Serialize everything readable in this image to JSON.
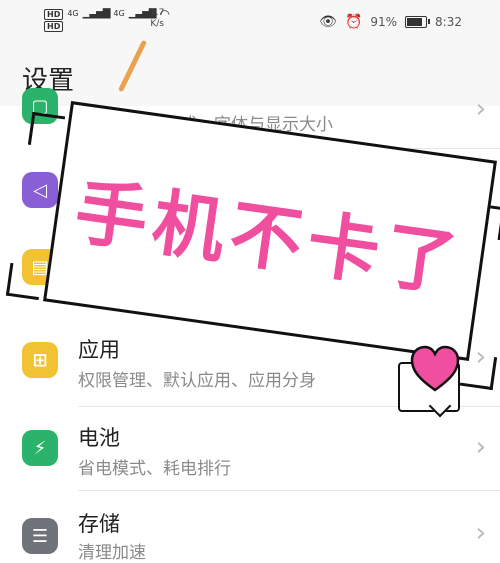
{
  "status_bar": {
    "hd1": "HD",
    "hd2": "HD",
    "net1": "4G",
    "net2": "4G",
    "speed_value": "1.7",
    "speed_unit": "K/s",
    "battery_percent": "91%",
    "battery_level": 0.91,
    "time": "8:32"
  },
  "header": {
    "title": "设置"
  },
  "sticker": {
    "text": "手机不卡了"
  },
  "settings": {
    "display": {
      "subtitle": "亮度、护眼模式、字体与显示大小",
      "color": "#2bb36b"
    },
    "sound": {
      "color": "#8a5fd6"
    },
    "notifications": {
      "color": "#f1c232"
    },
    "apps": {
      "title": "应用",
      "subtitle": "权限管理、默认应用、应用分身",
      "color": "#f1c232"
    },
    "battery": {
      "title": "电池",
      "subtitle": "省电模式、耗电排行",
      "color": "#2bb36b"
    },
    "storage": {
      "title": "存储",
      "subtitle": "清理加速",
      "color": "#6f7379"
    }
  },
  "colors": {
    "sticker_text": "#f04fa0",
    "heart": "#f04fa0",
    "pen": "#e9a24e"
  }
}
